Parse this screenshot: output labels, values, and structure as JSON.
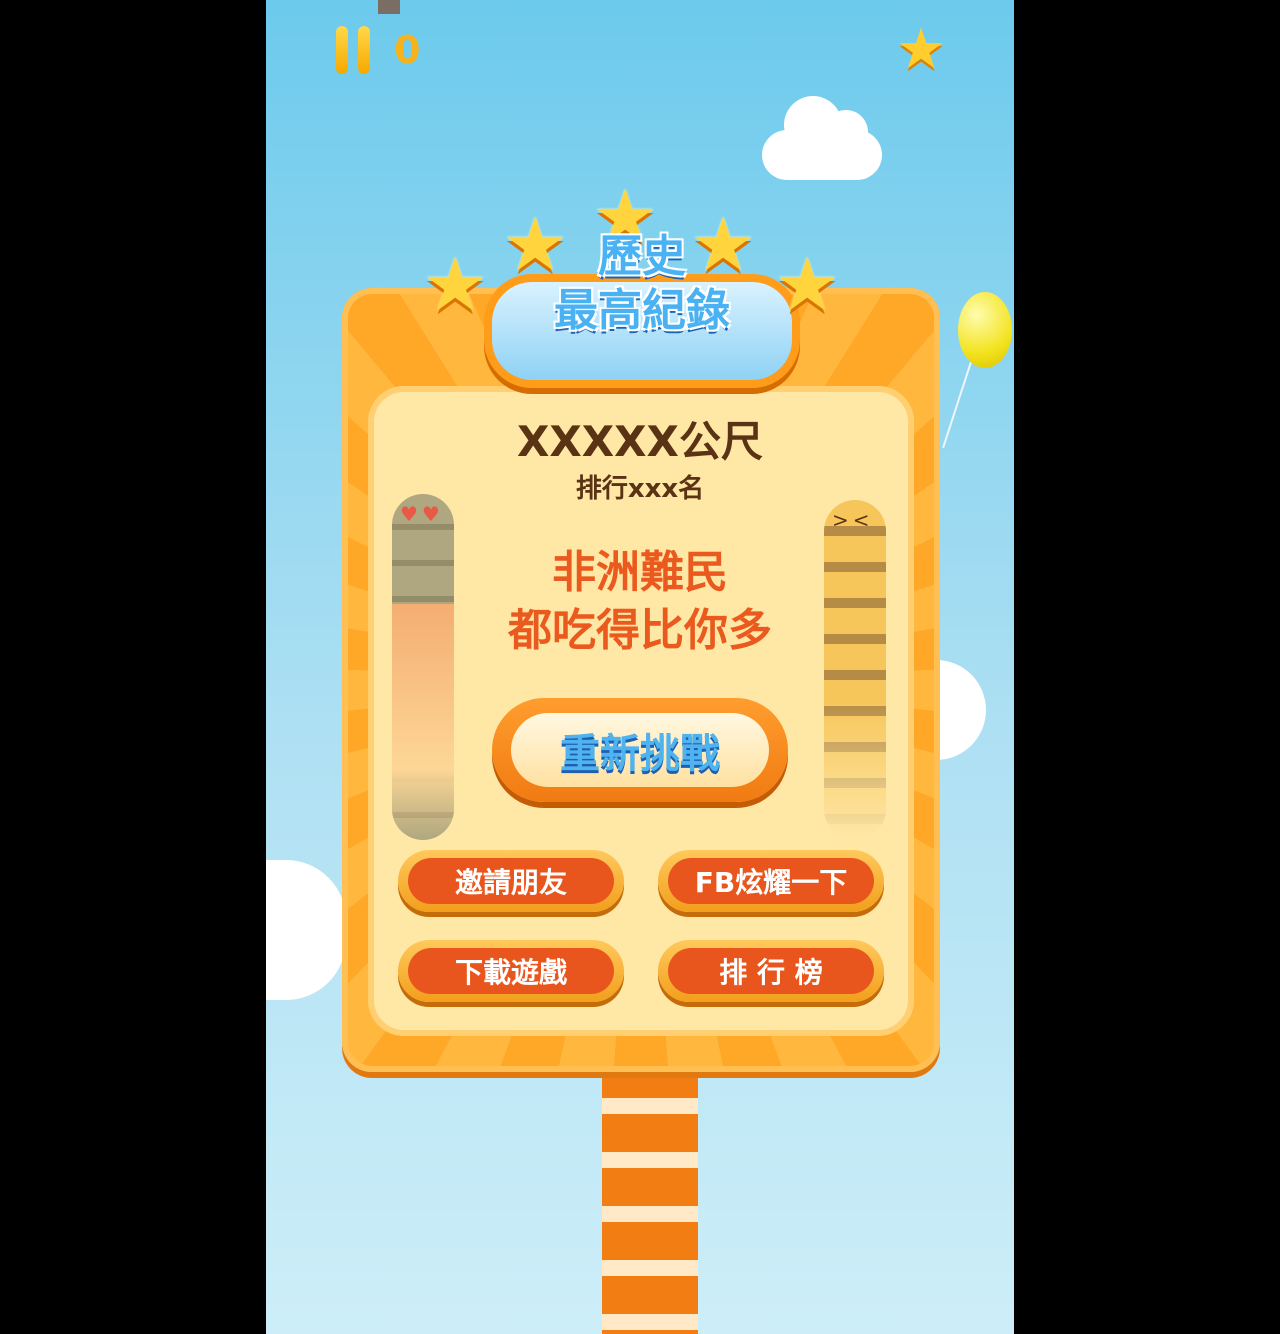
{
  "hud": {
    "score": "0"
  },
  "title": {
    "line1": "歷史",
    "line2": "最高紀錄"
  },
  "result": {
    "distance": "XXXXX公尺",
    "rank": "排行xxx名"
  },
  "message": {
    "line1": "非洲難民",
    "line2": "都吃得比你多"
  },
  "buttons": {
    "retry": "重新挑戰",
    "invite": "邀請朋友",
    "fb_share": "FB炫耀一下",
    "download": "下載遊戲",
    "leaderboard": "排 行 榜"
  }
}
